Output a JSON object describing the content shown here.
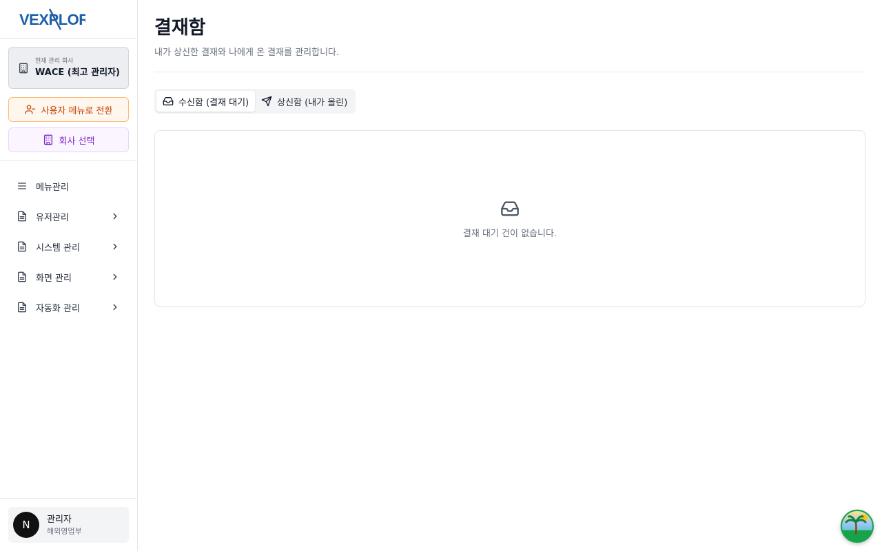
{
  "brand": {
    "logo_text": "VEXPLOR",
    "logo_color": "#1e5fa8"
  },
  "sidebar": {
    "company": {
      "caption": "현재 관리 회사",
      "name": "WACE (최고 관리자)"
    },
    "switch_menu_label": "사용자 메뉴로 전환",
    "select_company_label": "회사 선택",
    "items": [
      {
        "label": "메뉴관리",
        "icon": "menu-icon",
        "expandable": false
      },
      {
        "label": "유저관리",
        "icon": "document-icon",
        "expandable": true
      },
      {
        "label": "시스템 관리",
        "icon": "document-icon",
        "expandable": true
      },
      {
        "label": "화면 관리",
        "icon": "document-icon",
        "expandable": true
      },
      {
        "label": "자동화 관리",
        "icon": "document-icon",
        "expandable": true
      }
    ],
    "user": {
      "initial": "N",
      "name": "관리자",
      "department": "해외영업부"
    }
  },
  "main": {
    "title": "결재함",
    "description": "내가 상신한 결재와 나에게 온 결재를 관리합니다.",
    "tabs": [
      {
        "label": "수신함 (결재 대기)",
        "icon": "inbox-icon",
        "active": true
      },
      {
        "label": "상신함 (내가 올린)",
        "icon": "send-icon",
        "active": false
      }
    ],
    "empty_message": "결재 대기 건이 없습니다."
  },
  "colors": {
    "switch_accent": "#c2410c",
    "select_accent": "#7e22ce"
  }
}
